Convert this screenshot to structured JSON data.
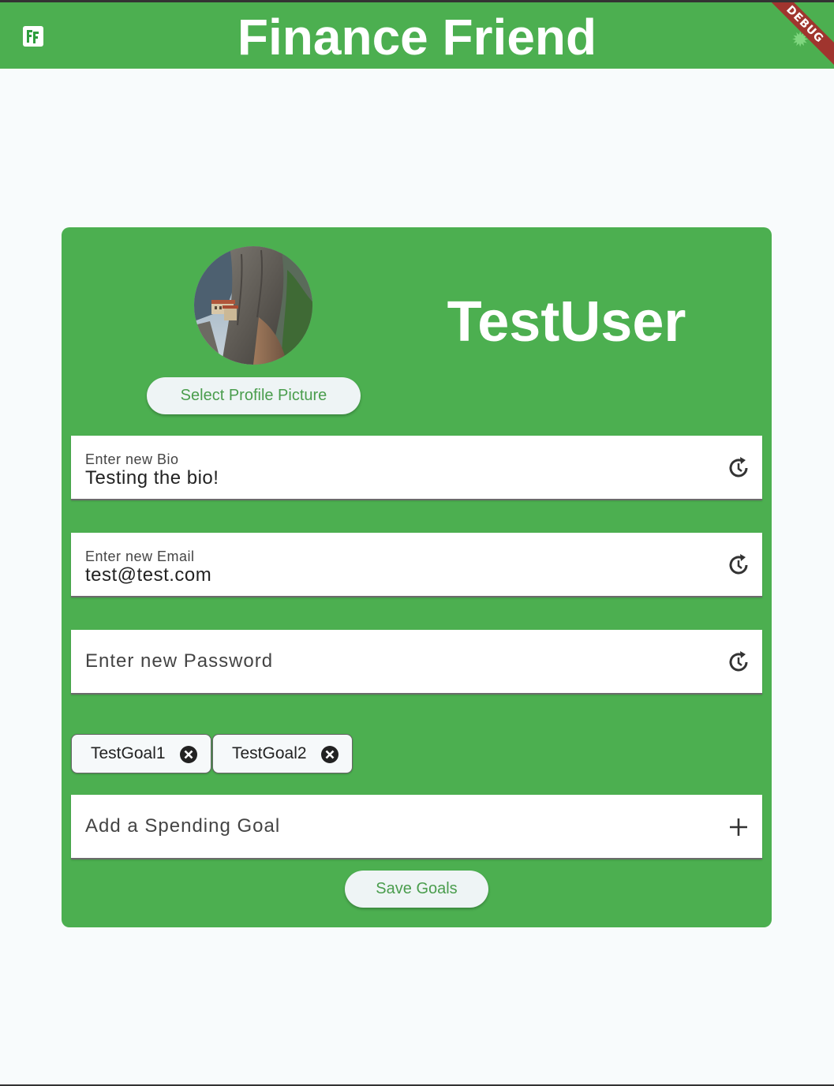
{
  "app": {
    "title": "Finance Friend",
    "logo_text": "FF",
    "debug_label": "DEBUG"
  },
  "profile": {
    "username": "TestUser",
    "select_picture_label": "Select Profile Picture"
  },
  "fields": {
    "bio": {
      "label": "Enter new Bio",
      "value": "Testing the bio!"
    },
    "email": {
      "label": "Enter new Email",
      "value": "test@test.com"
    },
    "password": {
      "label": "Enter new Password",
      "value": ""
    },
    "goal": {
      "label": "Add a Spending Goal",
      "value": ""
    }
  },
  "goals": [
    {
      "label": "TestGoal1"
    },
    {
      "label": "TestGoal2"
    }
  ],
  "actions": {
    "save_goals_label": "Save Goals"
  },
  "colors": {
    "primary": "#4caf50",
    "background": "#f8fbfc",
    "button_text": "#4a9d4d",
    "debug_banner": "#a0352e"
  },
  "icons": {
    "field_reset": "history-reset-icon",
    "goal_add": "plus-icon",
    "chip_delete": "cancel-circle-icon"
  }
}
